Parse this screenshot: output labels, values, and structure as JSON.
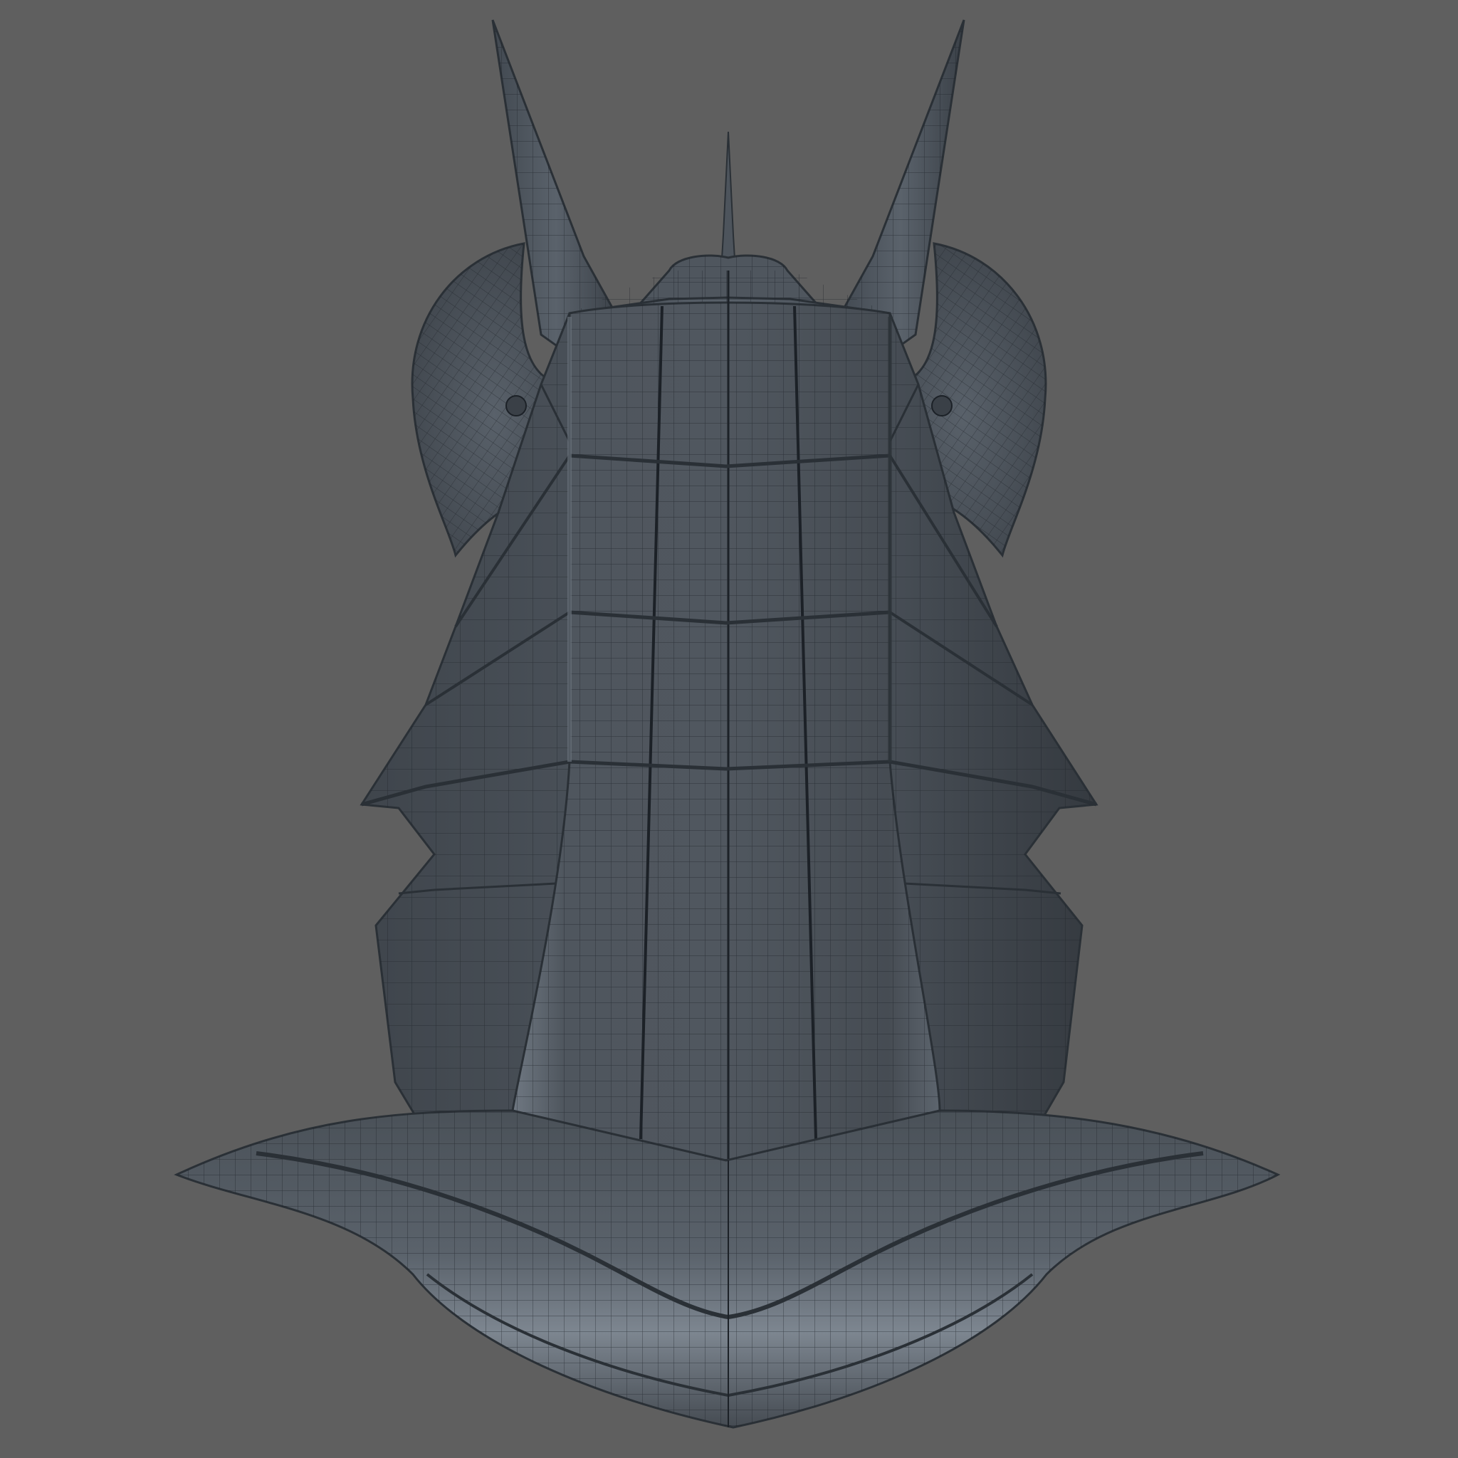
{
  "scene": {
    "background_color": "#5f5f5f",
    "model": {
      "subject": "wireframe-helmet-model",
      "surface_color": "#4a5058",
      "highlight_color": "#8a939c",
      "wire_color": "#1c2127",
      "edge_color": "#2a3036"
    }
  }
}
